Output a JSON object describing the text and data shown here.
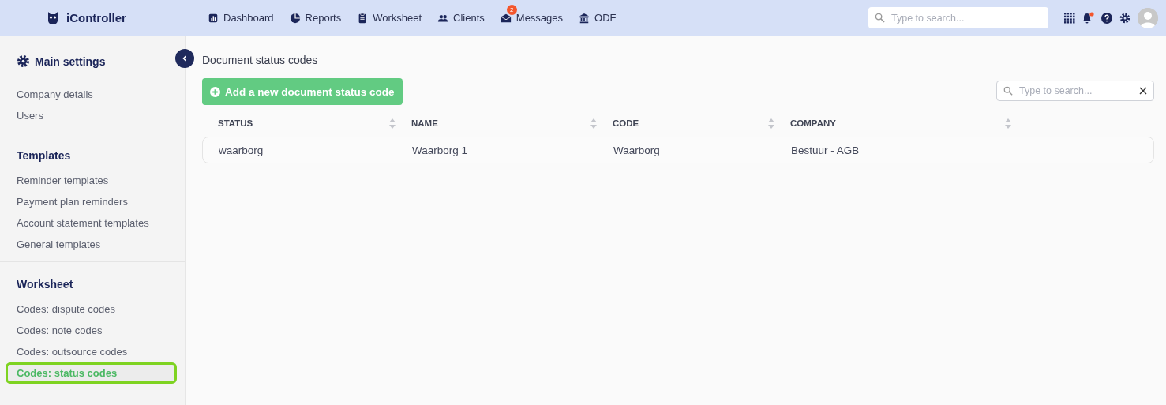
{
  "brand": {
    "name": "iController"
  },
  "nav": [
    {
      "label": "Dashboard"
    },
    {
      "label": "Reports"
    },
    {
      "label": "Worksheet"
    },
    {
      "label": "Clients"
    },
    {
      "label": "Messages",
      "badge": "2"
    },
    {
      "label": "ODF"
    }
  ],
  "top_search": {
    "placeholder": "Type to search..."
  },
  "notifications": {
    "unread": true
  },
  "sidebar": {
    "title": "Main settings",
    "sections": [
      {
        "items": [
          {
            "label": "Company details",
            "selected": false
          },
          {
            "label": "Users",
            "selected": false
          }
        ]
      },
      {
        "heading": "Templates",
        "items": [
          {
            "label": "Reminder templates",
            "selected": false
          },
          {
            "label": "Payment plan reminders",
            "selected": false
          },
          {
            "label": "Account statement templates",
            "selected": false
          },
          {
            "label": "General templates",
            "selected": false
          }
        ]
      },
      {
        "heading": "Worksheet",
        "items": [
          {
            "label": "Codes: dispute codes",
            "selected": false
          },
          {
            "label": "Codes: note codes",
            "selected": false
          },
          {
            "label": "Codes: outsource codes",
            "selected": false
          },
          {
            "label": "Codes: status codes",
            "selected": true
          }
        ]
      }
    ]
  },
  "page": {
    "title": "Document status codes",
    "add_button": "Add a new document status code",
    "search": {
      "placeholder": "Type to search..."
    }
  },
  "table": {
    "columns": [
      "STATUS",
      "NAME",
      "CODE",
      "COMPANY"
    ],
    "rows": [
      [
        "waarborg",
        "Waarborg 1",
        "Waarborg",
        "Bestuur - AGB"
      ]
    ]
  }
}
